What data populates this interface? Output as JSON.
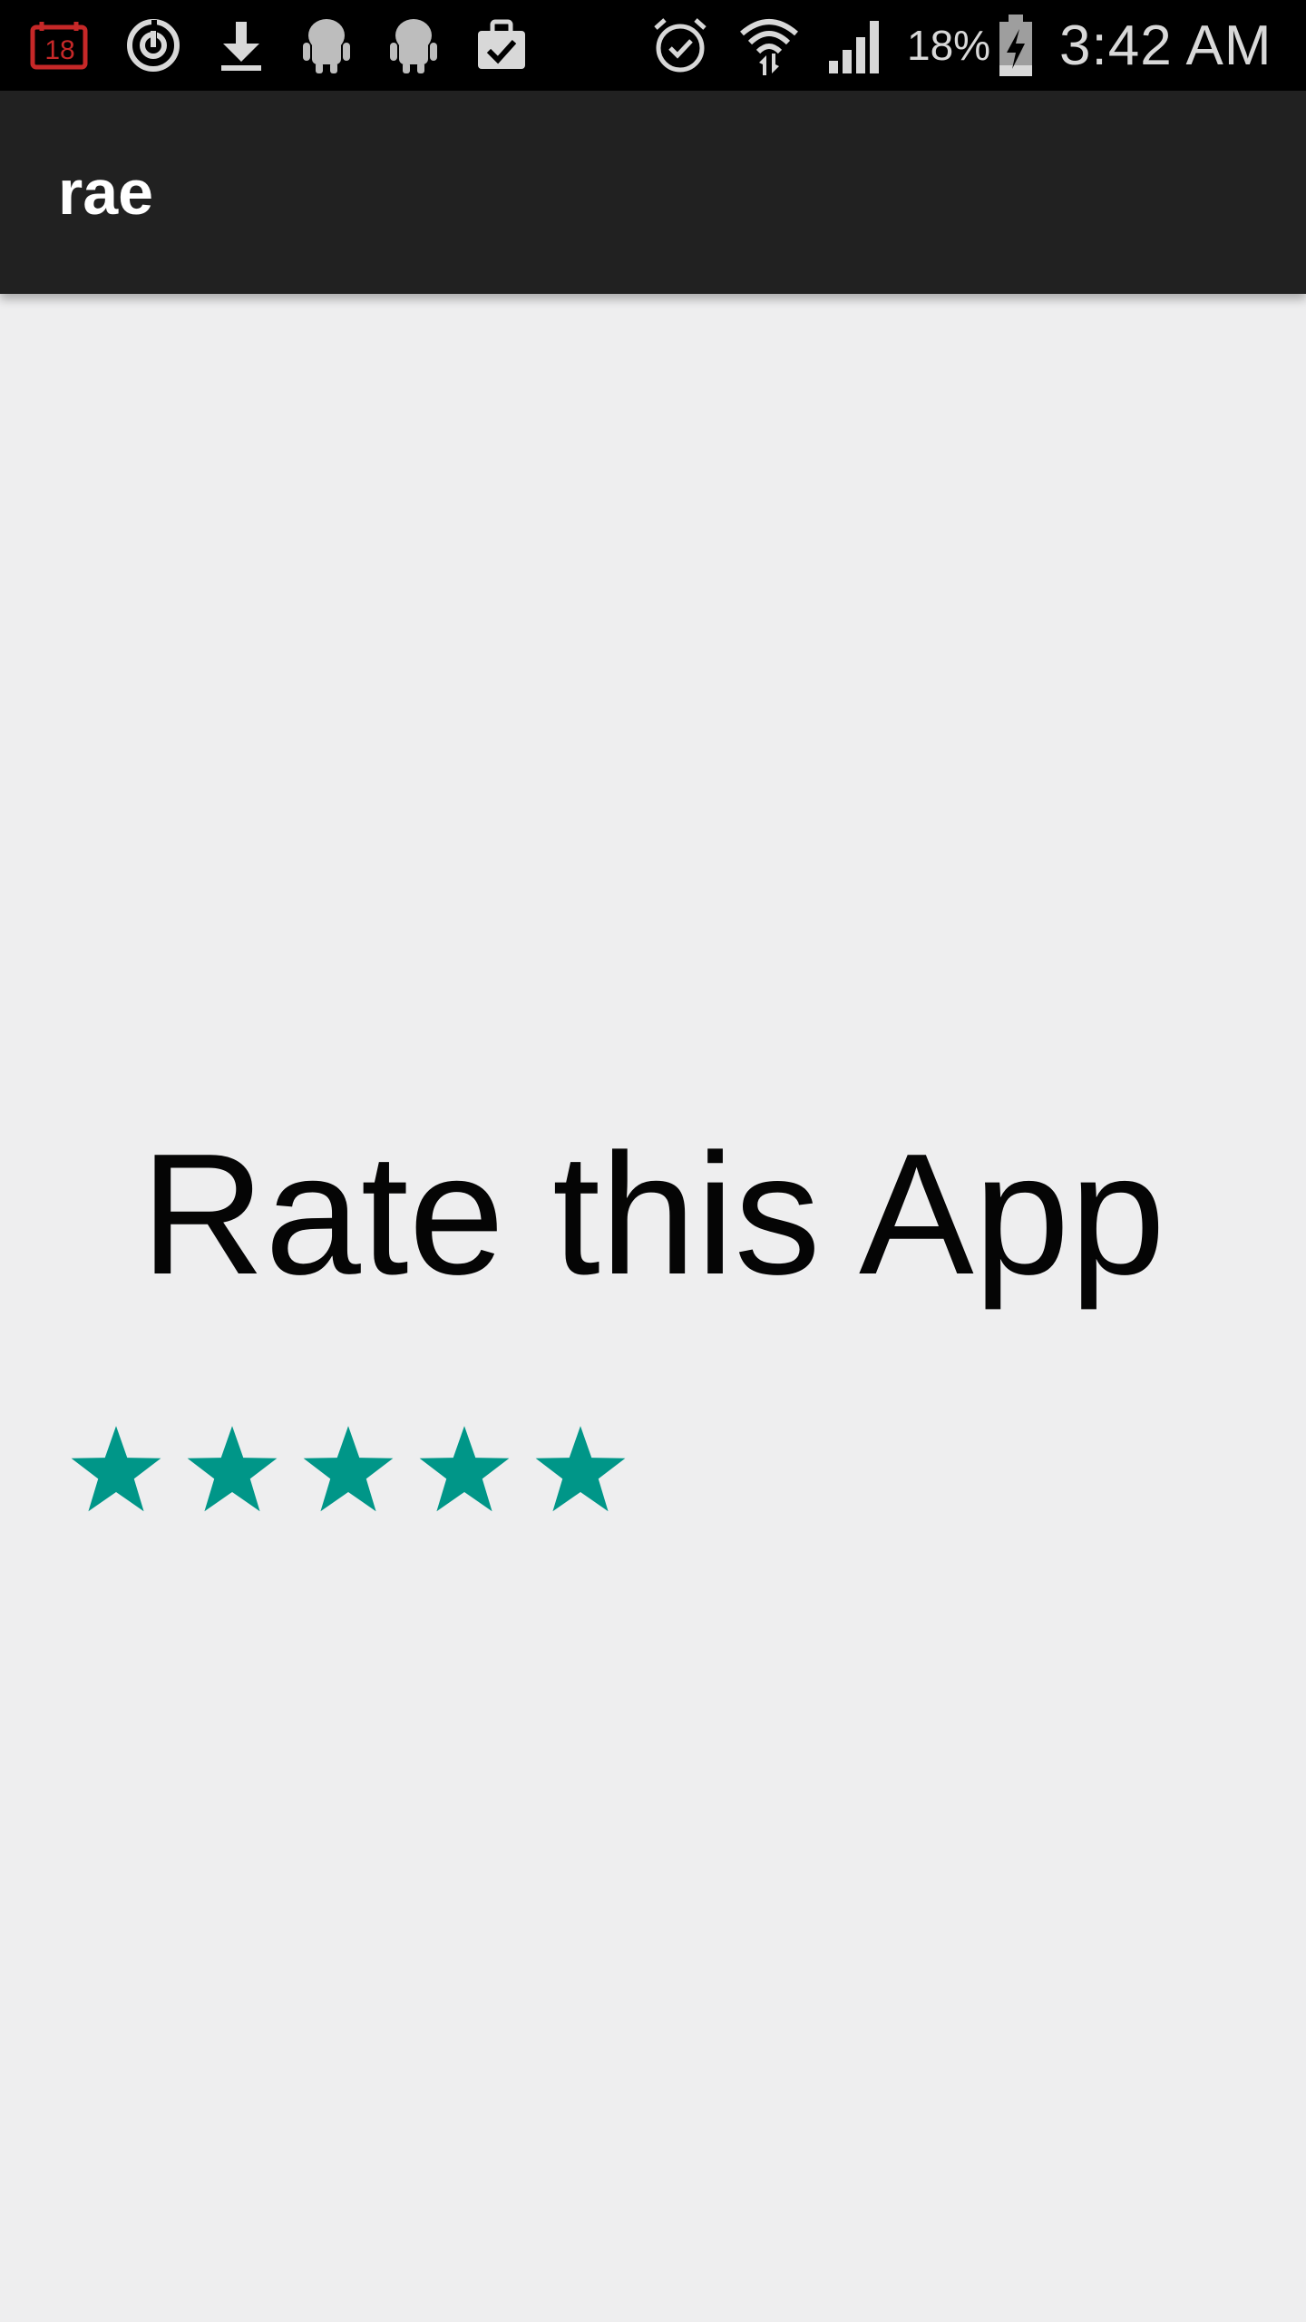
{
  "status_bar": {
    "notification_icons": [
      "calendar-18-icon",
      "sync-icon",
      "download-icon",
      "android-icon",
      "android-icon",
      "clipboard-check-icon"
    ],
    "calendar_day": "18",
    "system_icons": [
      "alarm-icon",
      "wifi-icon",
      "signal-icon",
      "battery-charging-icon"
    ],
    "battery_percent": "18%",
    "time": "3:42 AM"
  },
  "app_bar": {
    "title": "rae"
  },
  "main": {
    "heading": "Rate this App",
    "rating": {
      "stars_total": 5,
      "stars_filled": 5,
      "color": "#009688"
    }
  }
}
